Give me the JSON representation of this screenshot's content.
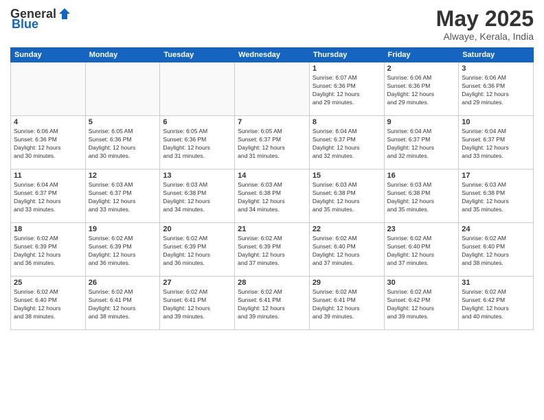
{
  "logo": {
    "general": "General",
    "blue": "Blue"
  },
  "title": "May 2025",
  "location": "Alwaye, Kerala, India",
  "weekdays": [
    "Sunday",
    "Monday",
    "Tuesday",
    "Wednesday",
    "Thursday",
    "Friday",
    "Saturday"
  ],
  "weeks": [
    [
      {
        "day": "",
        "info": ""
      },
      {
        "day": "",
        "info": ""
      },
      {
        "day": "",
        "info": ""
      },
      {
        "day": "",
        "info": ""
      },
      {
        "day": "1",
        "info": "Sunrise: 6:07 AM\nSunset: 6:36 PM\nDaylight: 12 hours\nand 29 minutes."
      },
      {
        "day": "2",
        "info": "Sunrise: 6:06 AM\nSunset: 6:36 PM\nDaylight: 12 hours\nand 29 minutes."
      },
      {
        "day": "3",
        "info": "Sunrise: 6:06 AM\nSunset: 6:36 PM\nDaylight: 12 hours\nand 29 minutes."
      }
    ],
    [
      {
        "day": "4",
        "info": "Sunrise: 6:06 AM\nSunset: 6:36 PM\nDaylight: 12 hours\nand 30 minutes."
      },
      {
        "day": "5",
        "info": "Sunrise: 6:05 AM\nSunset: 6:36 PM\nDaylight: 12 hours\nand 30 minutes."
      },
      {
        "day": "6",
        "info": "Sunrise: 6:05 AM\nSunset: 6:36 PM\nDaylight: 12 hours\nand 31 minutes."
      },
      {
        "day": "7",
        "info": "Sunrise: 6:05 AM\nSunset: 6:37 PM\nDaylight: 12 hours\nand 31 minutes."
      },
      {
        "day": "8",
        "info": "Sunrise: 6:04 AM\nSunset: 6:37 PM\nDaylight: 12 hours\nand 32 minutes."
      },
      {
        "day": "9",
        "info": "Sunrise: 6:04 AM\nSunset: 6:37 PM\nDaylight: 12 hours\nand 32 minutes."
      },
      {
        "day": "10",
        "info": "Sunrise: 6:04 AM\nSunset: 6:37 PM\nDaylight: 12 hours\nand 33 minutes."
      }
    ],
    [
      {
        "day": "11",
        "info": "Sunrise: 6:04 AM\nSunset: 6:37 PM\nDaylight: 12 hours\nand 33 minutes."
      },
      {
        "day": "12",
        "info": "Sunrise: 6:03 AM\nSunset: 6:37 PM\nDaylight: 12 hours\nand 33 minutes."
      },
      {
        "day": "13",
        "info": "Sunrise: 6:03 AM\nSunset: 6:38 PM\nDaylight: 12 hours\nand 34 minutes."
      },
      {
        "day": "14",
        "info": "Sunrise: 6:03 AM\nSunset: 6:38 PM\nDaylight: 12 hours\nand 34 minutes."
      },
      {
        "day": "15",
        "info": "Sunrise: 6:03 AM\nSunset: 6:38 PM\nDaylight: 12 hours\nand 35 minutes."
      },
      {
        "day": "16",
        "info": "Sunrise: 6:03 AM\nSunset: 6:38 PM\nDaylight: 12 hours\nand 35 minutes."
      },
      {
        "day": "17",
        "info": "Sunrise: 6:03 AM\nSunset: 6:38 PM\nDaylight: 12 hours\nand 35 minutes."
      }
    ],
    [
      {
        "day": "18",
        "info": "Sunrise: 6:02 AM\nSunset: 6:39 PM\nDaylight: 12 hours\nand 36 minutes."
      },
      {
        "day": "19",
        "info": "Sunrise: 6:02 AM\nSunset: 6:39 PM\nDaylight: 12 hours\nand 36 minutes."
      },
      {
        "day": "20",
        "info": "Sunrise: 6:02 AM\nSunset: 6:39 PM\nDaylight: 12 hours\nand 36 minutes."
      },
      {
        "day": "21",
        "info": "Sunrise: 6:02 AM\nSunset: 6:39 PM\nDaylight: 12 hours\nand 37 minutes."
      },
      {
        "day": "22",
        "info": "Sunrise: 6:02 AM\nSunset: 6:40 PM\nDaylight: 12 hours\nand 37 minutes."
      },
      {
        "day": "23",
        "info": "Sunrise: 6:02 AM\nSunset: 6:40 PM\nDaylight: 12 hours\nand 37 minutes."
      },
      {
        "day": "24",
        "info": "Sunrise: 6:02 AM\nSunset: 6:40 PM\nDaylight: 12 hours\nand 38 minutes."
      }
    ],
    [
      {
        "day": "25",
        "info": "Sunrise: 6:02 AM\nSunset: 6:40 PM\nDaylight: 12 hours\nand 38 minutes."
      },
      {
        "day": "26",
        "info": "Sunrise: 6:02 AM\nSunset: 6:41 PM\nDaylight: 12 hours\nand 38 minutes."
      },
      {
        "day": "27",
        "info": "Sunrise: 6:02 AM\nSunset: 6:41 PM\nDaylight: 12 hours\nand 39 minutes."
      },
      {
        "day": "28",
        "info": "Sunrise: 6:02 AM\nSunset: 6:41 PM\nDaylight: 12 hours\nand 39 minutes."
      },
      {
        "day": "29",
        "info": "Sunrise: 6:02 AM\nSunset: 6:41 PM\nDaylight: 12 hours\nand 39 minutes."
      },
      {
        "day": "30",
        "info": "Sunrise: 6:02 AM\nSunset: 6:42 PM\nDaylight: 12 hours\nand 39 minutes."
      },
      {
        "day": "31",
        "info": "Sunrise: 6:02 AM\nSunset: 6:42 PM\nDaylight: 12 hours\nand 40 minutes."
      }
    ]
  ]
}
